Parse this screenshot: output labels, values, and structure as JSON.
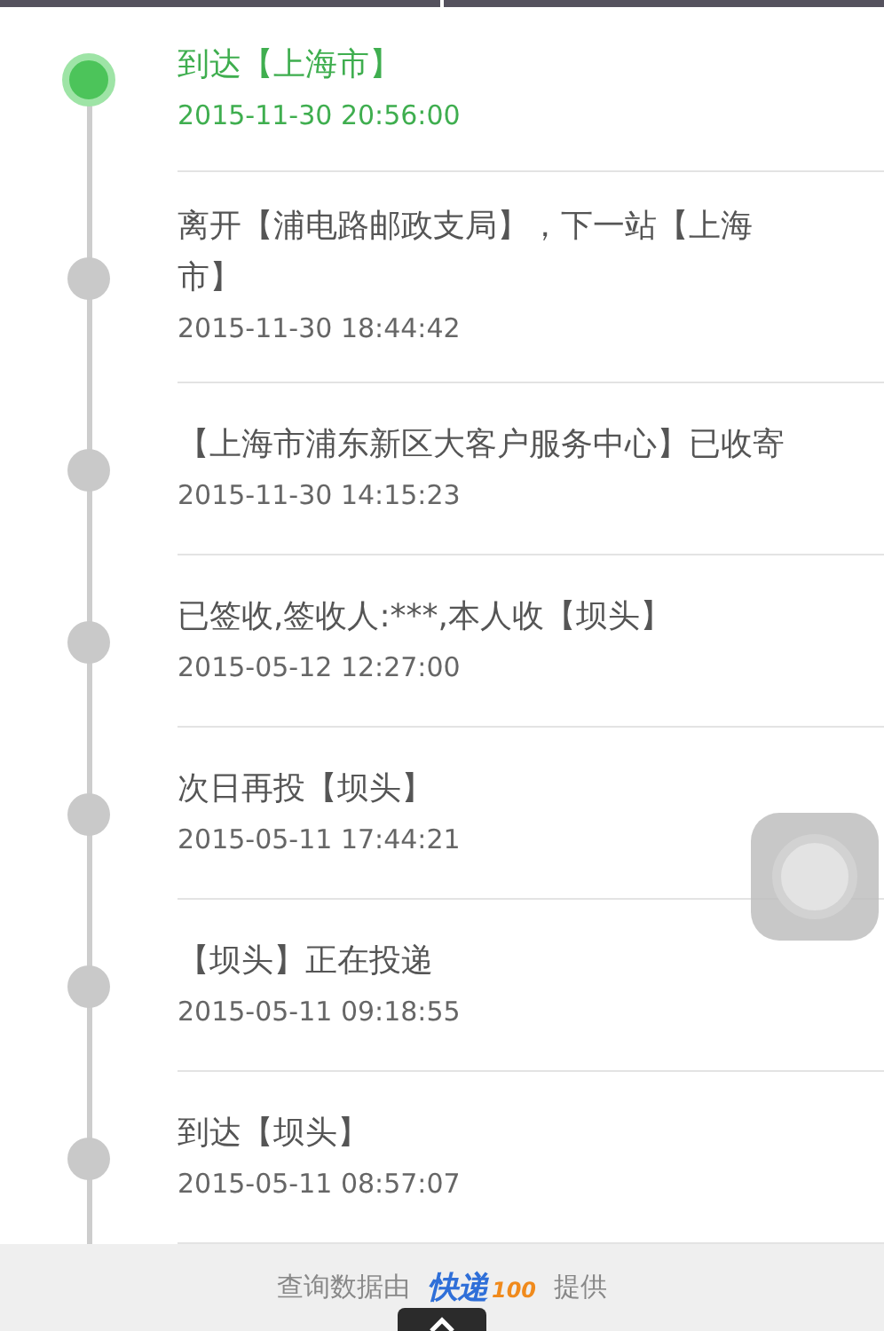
{
  "events": [
    {
      "title": "到达【上海市】",
      "time": "2015-11-30 20:56:00",
      "current": true
    },
    {
      "title": "离开【浦电路邮政支局】，下一站【上海市】",
      "time": "2015-11-30 18:44:42",
      "current": false
    },
    {
      "title": "【上海市浦东新区大客户服务中心】已收寄",
      "time": "2015-11-30 14:15:23",
      "current": false
    },
    {
      "title": "已签收,签收人:***,本人收【坝头】",
      "time": "2015-05-12 12:27:00",
      "current": false
    },
    {
      "title": "次日再投【坝头】",
      "time": "2015-05-11 17:44:21",
      "current": false
    },
    {
      "title": "【坝头】正在投递",
      "time": "2015-05-11 09:18:55",
      "current": false
    },
    {
      "title": "到达【坝头】",
      "time": "2015-05-11 08:57:07",
      "current": false
    }
  ],
  "footer": {
    "prefix": "查询数据由",
    "logo_main": "快递",
    "logo_suffix": "100",
    "suffix": "提供"
  }
}
